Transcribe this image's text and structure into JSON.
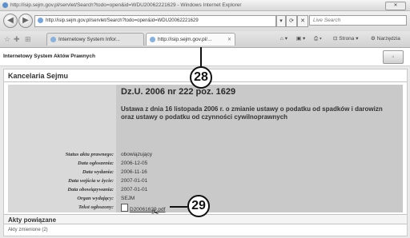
{
  "browser": {
    "title": "http://isip.sejm.gov.pl/servlet/Search?todo=open&id=WDU20062221629 - Windows Internet Explorer",
    "address": "http://isip.sejm.gov.pl/servlet/Search?todo=open&id=WDU20062221629",
    "search_placeholder": "Live Search",
    "tabs": [
      {
        "label": "Internetowy System Infor..."
      },
      {
        "label": "http://isip.sejm.gov.pl/..."
      }
    ],
    "page_menu": "Strona",
    "tools_menu": "Narzędzia"
  },
  "site": {
    "name": "Internetowy System Aktów Prawnych"
  },
  "page": {
    "section": "Kancelaria Sejmu",
    "doc_number": "Dz.U. 2006 nr 222 poz. 1629",
    "act_title": "Ustawa z dnia 16 listopada 2006 r. o zmianie ustawy o podatku od spadków i darowizn oraz ustawy o podatku od czynności cywilnoprawnych",
    "fields": [
      {
        "label": "Status aktu prawnego:",
        "value": "obowiązujący"
      },
      {
        "label": "Data ogłoszenia:",
        "value": "2006-12-05"
      },
      {
        "label": "Data wydania:",
        "value": "2006-11-16"
      },
      {
        "label": "Data wejścia w życie:",
        "value": "2007-01-01"
      },
      {
        "label": "Data obowiązywania:",
        "value": "2007-01-01"
      },
      {
        "label": "Organ wydający:",
        "value": "SEJM"
      }
    ],
    "text_label": "Tekst ogłoszony:",
    "pdf_link": "D20061629.pdf",
    "related_title": "Akty powiązane",
    "related_item": "Akty zmienione (2)"
  },
  "callouts": {
    "first": "28",
    "second": "29"
  }
}
